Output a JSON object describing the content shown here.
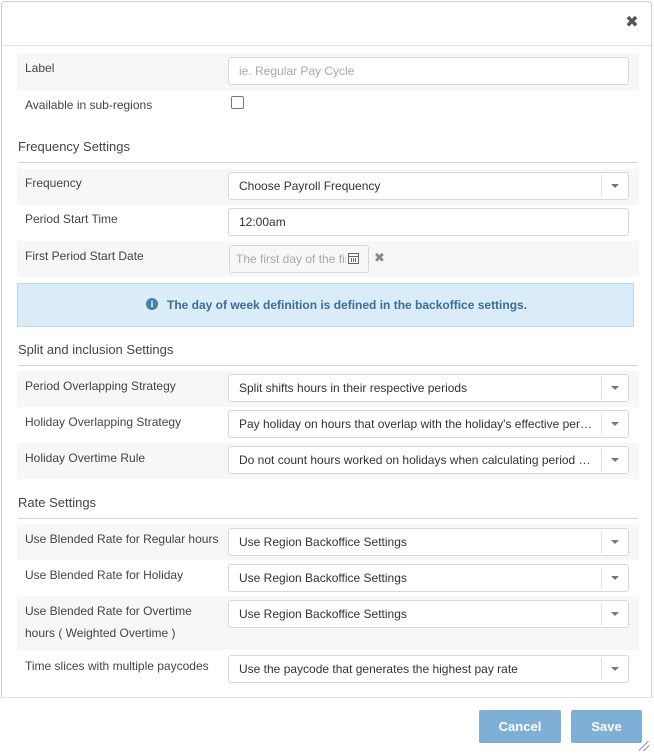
{
  "header": {
    "close_glyph": "✖"
  },
  "general": {
    "label": {
      "label": "Label",
      "placeholder": "ie. Regular Pay Cycle",
      "value": ""
    },
    "sub_regions": {
      "label": "Available in sub-regions",
      "checked": false
    }
  },
  "frequency_section": {
    "title": "Frequency Settings",
    "frequency": {
      "label": "Frequency",
      "value": "Choose Payroll Frequency"
    },
    "period_start_time": {
      "label": "Period Start Time",
      "value": "12:00am"
    },
    "first_period_start_date": {
      "label": "First Period Start Date",
      "placeholder": "The first day of the first"
    },
    "clear_glyph": "✖",
    "info": {
      "icon": "info-icon",
      "text": "The day of week definition is defined in the backoffice settings."
    }
  },
  "split_section": {
    "title": "Split and inclusion Settings",
    "period_overlap": {
      "label": "Period Overlapping Strategy",
      "value": "Split shifts hours in their respective periods"
    },
    "holiday_overlap": {
      "label": "Holiday Overlapping Strategy",
      "value": "Pay holiday on hours that overlap with the holiday's effective period"
    },
    "holiday_overtime": {
      "label": "Holiday Overtime Rule",
      "value": "Do not count hours worked on holidays when calculating period overtime"
    }
  },
  "rate_section": {
    "title": "Rate Settings",
    "blended_regular": {
      "label": "Use Blended Rate for Regular hours",
      "value": "Use Region Backoffice Settings"
    },
    "blended_holiday": {
      "label": "Use Blended Rate for Holiday",
      "value": "Use Region Backoffice Settings"
    },
    "blended_overtime": {
      "label_line1": "Use Blended Rate for Overtime",
      "label_line2": "hours ( Weighted Overtime )",
      "value": "Use Region Backoffice Settings"
    },
    "time_slices": {
      "label": "Time slices with multiple paycodes",
      "value": "Use the paycode that generates the highest pay rate"
    }
  },
  "footer": {
    "cancel_label": "Cancel",
    "save_label": "Save"
  },
  "colors": {
    "button": "#7faed6",
    "info_bg": "#d9ecf8",
    "info_text": "#3b6e99"
  }
}
